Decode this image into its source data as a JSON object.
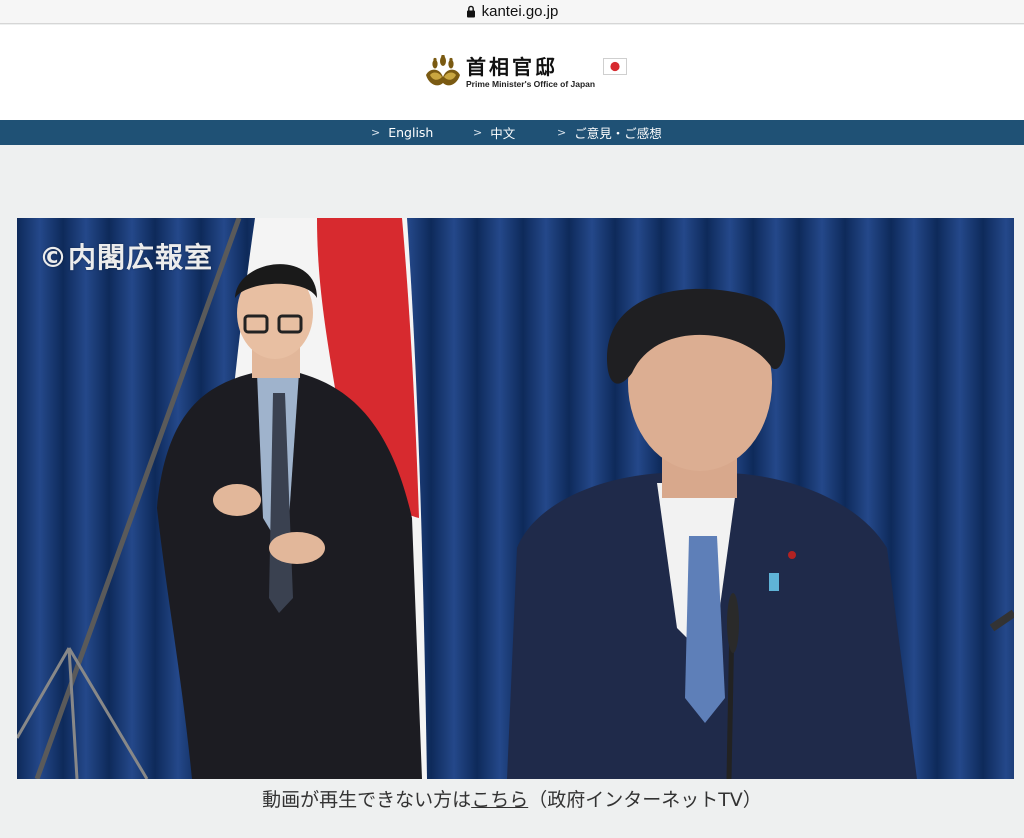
{
  "browser": {
    "url": "kantei.go.jp"
  },
  "header": {
    "logo_jp": "首相官邸",
    "logo_en": "Prime Minister's Office of Japan"
  },
  "nav": {
    "items": [
      {
        "label": "English"
      },
      {
        "label": "中文"
      },
      {
        "label": "ご意見・ご感想"
      }
    ]
  },
  "video": {
    "watermark": "©内閣広報室"
  },
  "caption": {
    "prefix": "動画が再生できない方は",
    "link": "こちら",
    "suffix": "（政府インターネットTV）"
  },
  "colors": {
    "nav_bar": "#1f5175",
    "page_bg": "#eef0f0",
    "curtain": "#1a3b73",
    "flag_red": "#d72a2f"
  },
  "icons": [
    "lock-icon",
    "kiri-crest-icon",
    "japan-flag-icon",
    "chevron-right-icon"
  ]
}
